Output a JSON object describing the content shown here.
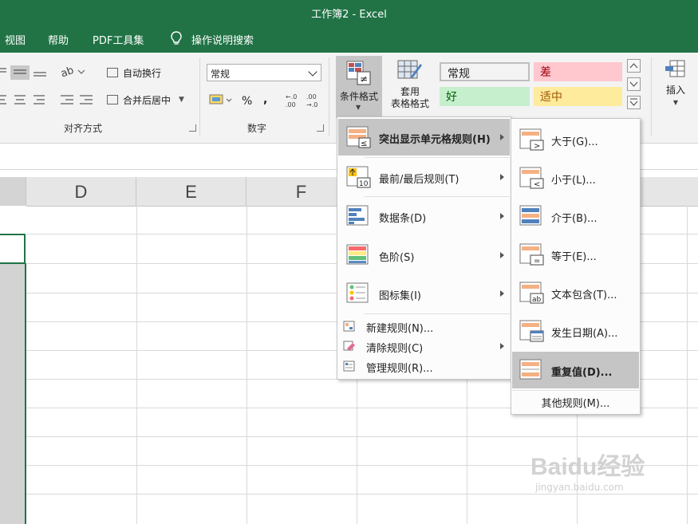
{
  "window": {
    "title": "工作簿2  -  Excel"
  },
  "tabs": [
    "视图",
    "帮助",
    "PDF工具集"
  ],
  "tell_me": {
    "label": "操作说明搜索",
    "icon": "lightbulb-icon"
  },
  "ribbon": {
    "alignment": {
      "wrap_text": "自动换行",
      "merge_center": "合并后居中",
      "group_label": "对齐方式"
    },
    "number": {
      "format_value": "常规",
      "percent": "%",
      "comma": ",",
      "group_label": "数字"
    },
    "styles": {
      "conditional_formatting": "条件格式",
      "format_as_table_line1": "套用",
      "format_as_table_line2": "表格格式",
      "cell_styles": [
        {
          "label": "常规",
          "bg": "#ffffff",
          "fg": "#000000"
        },
        {
          "label": "差",
          "bg": "#ffc7ce",
          "fg": "#9c0006"
        },
        {
          "label": "好",
          "bg": "#c6efce",
          "fg": "#006100"
        },
        {
          "label": "适中",
          "bg": "#ffeb9c",
          "fg": "#9c5700"
        }
      ]
    },
    "cells": {
      "insert": "插入"
    }
  },
  "columns": [
    "D",
    "E",
    "F"
  ],
  "cf_menu": {
    "items": [
      {
        "label": "突出显示单元格规则(H)",
        "icon": "highlight-cells-rules-icon",
        "highlighted": true
      },
      {
        "label": "最前/最后规则(T)",
        "icon": "top-bottom-rules-icon"
      },
      {
        "label": "数据条(D)",
        "icon": "data-bars-icon"
      },
      {
        "label": "色阶(S)",
        "icon": "color-scales-icon"
      },
      {
        "label": "图标集(I)",
        "icon": "icon-sets-icon"
      }
    ],
    "small_items": [
      {
        "label": "新建规则(N)...",
        "icon": "new-rule-icon"
      },
      {
        "label": "清除规则(C)",
        "icon": "clear-rules-icon"
      },
      {
        "label": "管理规则(R)...",
        "icon": "manage-rules-icon"
      }
    ]
  },
  "sub_menu": {
    "items": [
      {
        "label": "大于(G)...",
        "icon": "greater-than-icon"
      },
      {
        "label": "小于(L)...",
        "icon": "less-than-icon"
      },
      {
        "label": "介于(B)...",
        "icon": "between-icon"
      },
      {
        "label": "等于(E)...",
        "icon": "equal-to-icon"
      },
      {
        "label": "文本包含(T)...",
        "icon": "text-contains-icon"
      },
      {
        "label": "发生日期(A)...",
        "icon": "date-occurring-icon"
      },
      {
        "label": "重复值(D)...",
        "icon": "duplicate-values-icon",
        "highlighted": true
      }
    ],
    "more_rules": "其他规则(M)..."
  },
  "watermark": {
    "brand": "Baidu经验",
    "url": "jingyan.baidu.com"
  },
  "colors": {
    "excel_green": "#217346",
    "menu_highlight": "#c5c5c5"
  }
}
